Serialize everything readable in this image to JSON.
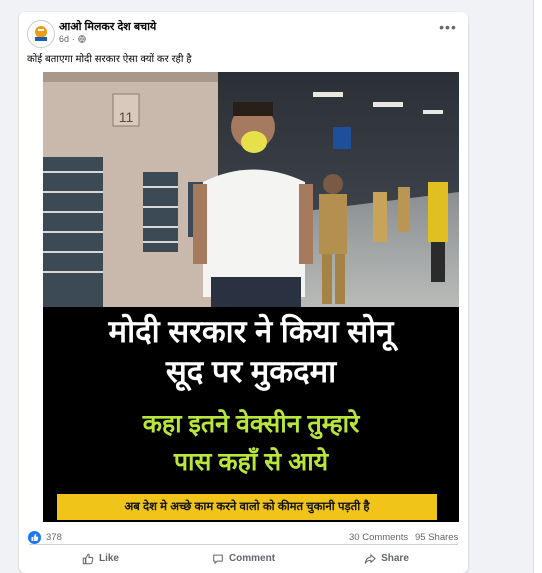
{
  "post": {
    "page_name": "आओ मिलकर देश बचाये",
    "time": "6d",
    "caption": "कोई बताएगा मोदी सरकार ऐसा क्यों कर रही है",
    "image_text": {
      "headline_line1": "मोदी सरकार ने किया सोनू",
      "headline_line2": "सूद पर मुकदमा",
      "sub_line1": "कहा इतने वेक्सीन तुम्हारे",
      "sub_line2": "पास कहाँ से आये",
      "banner": "अब देश मे अच्छे काम करने वालो को कीमत चुकानी पड़ती है",
      "train_number": "11"
    }
  },
  "stats": {
    "reactions": "378",
    "comments": "30 Comments",
    "shares": "95 Shares"
  },
  "actions": {
    "like": "Like",
    "comment": "Comment",
    "share": "Share"
  },
  "icons": [
    "globe-icon",
    "more-options-icon",
    "like-reaction-icon",
    "like-icon",
    "comment-icon",
    "share-icon"
  ],
  "colors": {
    "facebook_blue": "#1877f2",
    "headline_green": "#b8e63a",
    "banner_yellow": "#f0c419",
    "secondary_text": "#65676b"
  }
}
